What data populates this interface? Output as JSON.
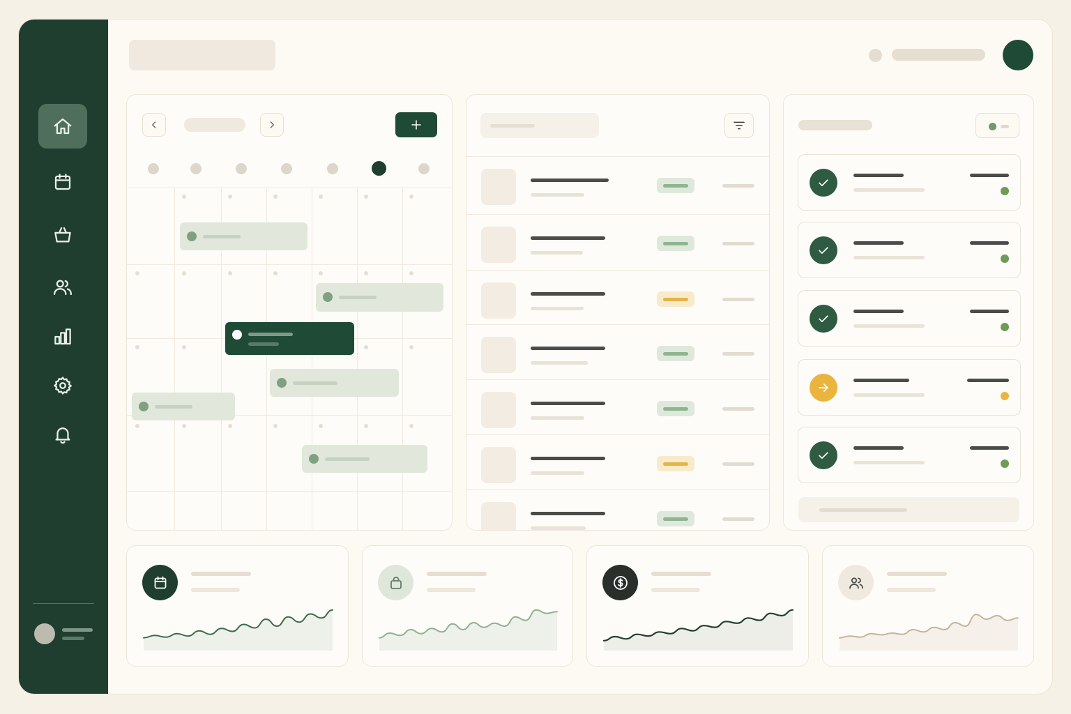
{
  "sidebar": {
    "items": [
      {
        "name": "home",
        "icon": "home-icon",
        "active": true
      },
      {
        "name": "calendar",
        "icon": "calendar-icon",
        "active": false
      },
      {
        "name": "orders",
        "icon": "shopping-basket-icon",
        "active": false
      },
      {
        "name": "customers",
        "icon": "users-icon",
        "active": false
      },
      {
        "name": "analytics",
        "icon": "bar-chart-icon",
        "active": false
      },
      {
        "name": "settings",
        "icon": "gear-icon",
        "active": false
      },
      {
        "name": "notifications",
        "icon": "bell-icon",
        "active": false
      }
    ]
  },
  "colors": {
    "sidebar": "#1f3e2f",
    "accent": "#1f4a36",
    "success": "#6f9a57",
    "warning": "#e9b53e",
    "background": "#fdfaf4"
  },
  "calendar": {
    "prev_icon": "chevron-left-icon",
    "next_icon": "chevron-right-icon",
    "add_icon": "plus-icon",
    "days": 7,
    "selected_day_index": 5,
    "events": [
      {
        "col": 1,
        "row": 0,
        "style": "light"
      },
      {
        "col": 4,
        "row": 1,
        "style": "light"
      },
      {
        "col": 2,
        "row": 1,
        "style": "dark"
      },
      {
        "col": 3,
        "row": 2,
        "style": "light"
      },
      {
        "col": 0,
        "row": 2,
        "style": "light"
      },
      {
        "col": 4,
        "row": 3,
        "style": "light"
      }
    ]
  },
  "list": {
    "filter_icon": "filter-icon",
    "rows": [
      {
        "status": "success"
      },
      {
        "status": "success"
      },
      {
        "status": "warning"
      },
      {
        "status": "success"
      },
      {
        "status": "success"
      },
      {
        "status": "warning"
      },
      {
        "status": "success"
      }
    ]
  },
  "tasks": {
    "items": [
      {
        "status": "done",
        "icon": "check-icon"
      },
      {
        "status": "done",
        "icon": "check-icon"
      },
      {
        "status": "done",
        "icon": "check-icon"
      },
      {
        "status": "in-progress",
        "icon": "arrow-right-icon"
      },
      {
        "status": "done",
        "icon": "check-icon"
      }
    ]
  },
  "stats": [
    {
      "name": "bookings",
      "icon": "calendar-icon",
      "trend": [
        10,
        14,
        11,
        17,
        13,
        22,
        16,
        26,
        21,
        33,
        27,
        42,
        30,
        46,
        37,
        51,
        44,
        58
      ]
    },
    {
      "name": "orders",
      "icon": "shopping-bag-icon",
      "trend": [
        10,
        18,
        14,
        24,
        17,
        26,
        20,
        34,
        24,
        36,
        28,
        35,
        30,
        46,
        40,
        58,
        52,
        55
      ]
    },
    {
      "name": "revenue",
      "icon": "dollar-icon",
      "trend": [
        5,
        12,
        8,
        16,
        13,
        20,
        17,
        26,
        22,
        31,
        28,
        38,
        35,
        44,
        40,
        52,
        48,
        58
      ]
    },
    {
      "name": "customers",
      "icon": "users-icon",
      "trend": [
        10,
        13,
        11,
        17,
        15,
        18,
        16,
        24,
        20,
        28,
        24,
        36,
        30,
        50,
        42,
        48,
        40,
        44
      ]
    }
  ]
}
